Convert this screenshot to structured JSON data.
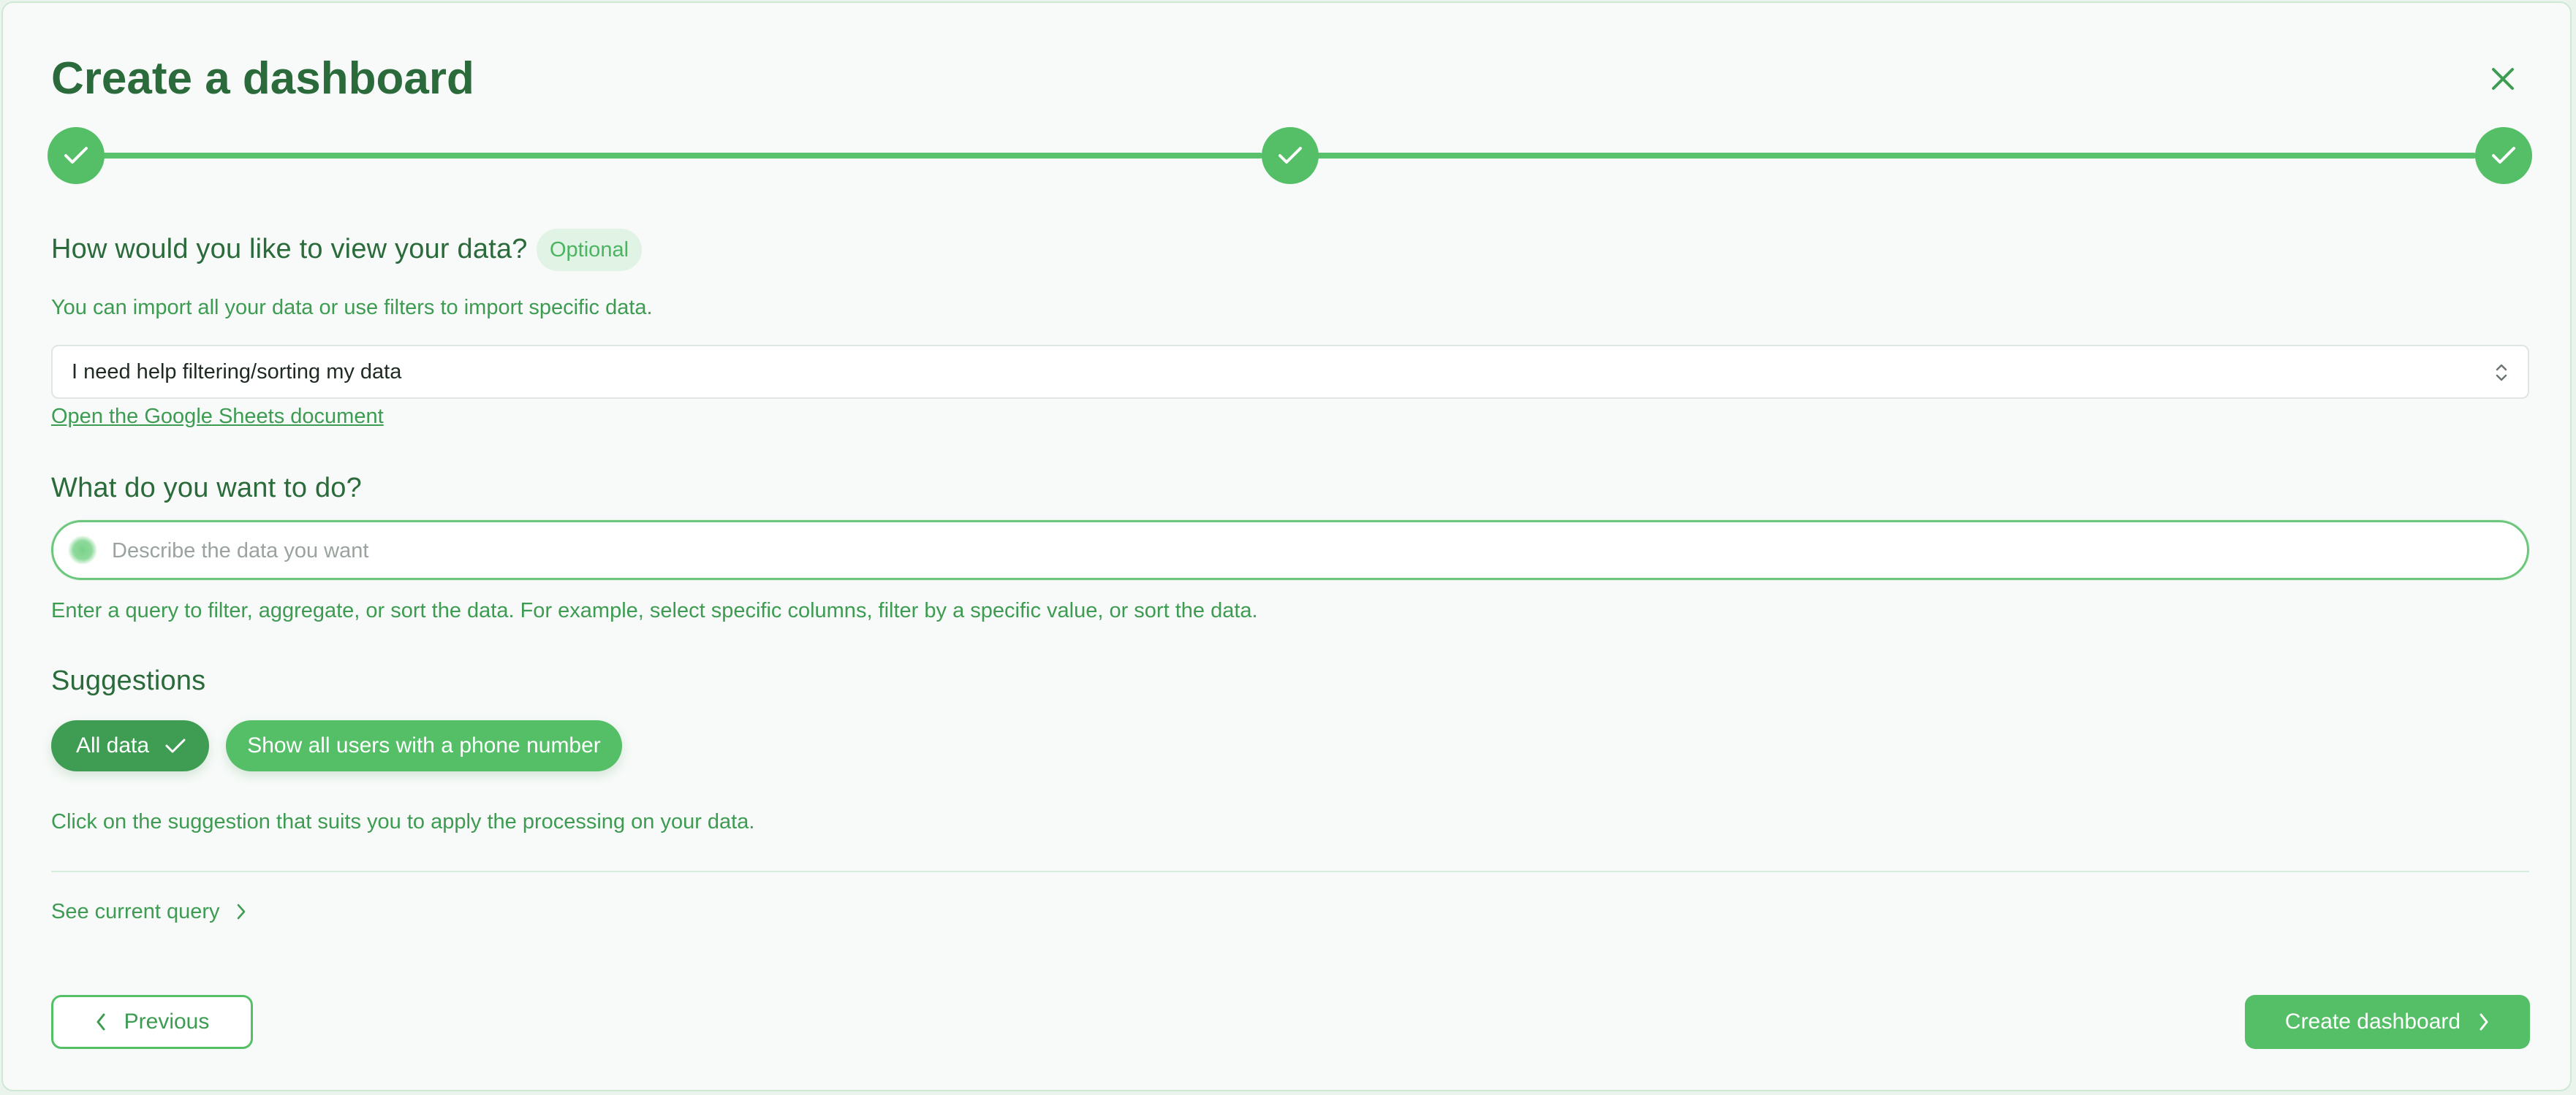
{
  "dialog": {
    "title": "Create a dashboard",
    "close_icon": "close-icon"
  },
  "stepper": {
    "steps": [
      {
        "status": "completed",
        "icon": "check-icon"
      },
      {
        "status": "completed",
        "icon": "check-icon"
      },
      {
        "status": "completed",
        "icon": "check-icon"
      }
    ],
    "color": "#55bf68"
  },
  "view_section": {
    "heading": "How would you like to view your data?",
    "badge": "Optional",
    "help": "You can import all your data or use filters to import specific data.",
    "select_value": "I need help filtering/sorting my data",
    "select_icon": "chevron-up-down-icon",
    "link": "Open the Google Sheets document"
  },
  "query_section": {
    "heading": "What do you want to do?",
    "placeholder": "Describe the data you want",
    "value": "",
    "help": "Enter a query to filter, aggregate, or sort the data. For example, select specific columns, filter by a specific value, or sort the data."
  },
  "suggestions": {
    "heading": "Suggestions",
    "items": [
      {
        "label": "All data",
        "selected": true
      },
      {
        "label": "Show all users with a phone number",
        "selected": false
      }
    ],
    "help": "Click on the suggestion that suits you to apply the processing on your data."
  },
  "current_query": {
    "label": "See current query",
    "icon": "chevron-right-icon"
  },
  "footer": {
    "previous_label": "Previous",
    "create_label": "Create dashboard"
  },
  "colors": {
    "primary": "#55bf68",
    "primary_dark": "#3e9d53",
    "heading": "#2b6a3a",
    "help_text": "#3d9b52",
    "background": "#f7faf8"
  }
}
